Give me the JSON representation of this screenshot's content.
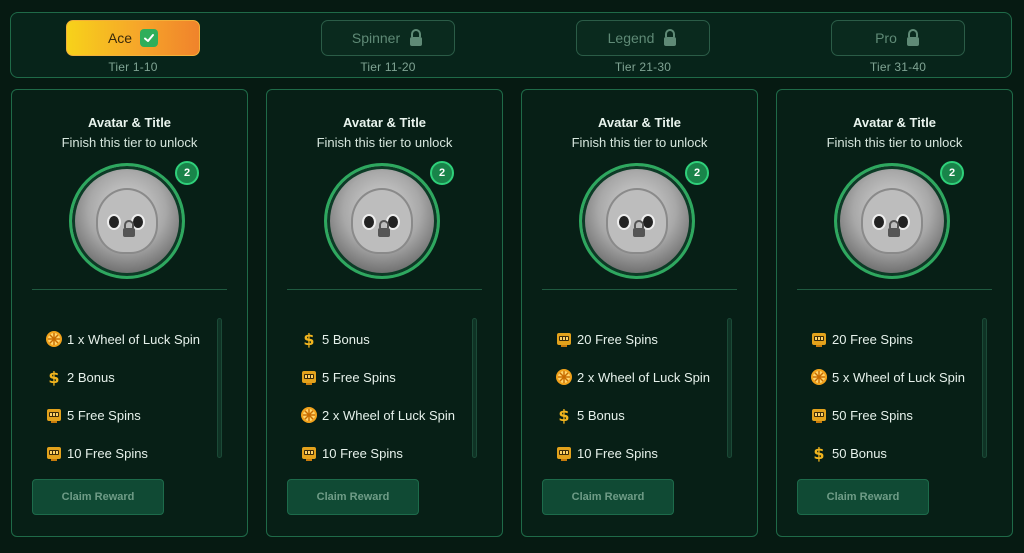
{
  "tiers": [
    {
      "name": "Ace",
      "range": "Tier 1-10",
      "active": true
    },
    {
      "name": "Spinner",
      "range": "Tier 11-20",
      "active": false
    },
    {
      "name": "Legend",
      "range": "Tier 21-30",
      "active": false
    },
    {
      "name": "Pro",
      "range": "Tier 31-40",
      "active": false
    }
  ],
  "cards": [
    {
      "title": "Avatar & Title",
      "subtitle": "Finish this tier to unlock",
      "badge": "2",
      "rewards": [
        {
          "icon": "wheel-icon",
          "label": "1 x Wheel of Luck Spin"
        },
        {
          "icon": "dollar-icon",
          "label": "2 Bonus"
        },
        {
          "icon": "slot-icon",
          "label": "5 Free Spins"
        },
        {
          "icon": "slot-icon",
          "label": "10 Free Spins"
        }
      ],
      "claim": "Claim Reward"
    },
    {
      "title": "Avatar & Title",
      "subtitle": "Finish this tier to unlock",
      "badge": "2",
      "rewards": [
        {
          "icon": "dollar-icon",
          "label": "5 Bonus"
        },
        {
          "icon": "slot-icon",
          "label": "5 Free Spins"
        },
        {
          "icon": "wheel-icon",
          "label": "2 x Wheel of Luck Spin"
        },
        {
          "icon": "slot-icon",
          "label": "10 Free Spins"
        }
      ],
      "claim": "Claim Reward"
    },
    {
      "title": "Avatar & Title",
      "subtitle": "Finish this tier to unlock",
      "badge": "2",
      "rewards": [
        {
          "icon": "slot-icon",
          "label": "20 Free Spins"
        },
        {
          "icon": "wheel-icon",
          "label": "2 x Wheel of Luck Spin"
        },
        {
          "icon": "dollar-icon",
          "label": "5 Bonus"
        },
        {
          "icon": "slot-icon",
          "label": "10 Free Spins"
        }
      ],
      "claim": "Claim Reward"
    },
    {
      "title": "Avatar & Title",
      "subtitle": "Finish this tier to unlock",
      "badge": "2",
      "rewards": [
        {
          "icon": "slot-icon",
          "label": "20 Free Spins"
        },
        {
          "icon": "wheel-icon",
          "label": "5 x Wheel of Luck Spin"
        },
        {
          "icon": "slot-icon",
          "label": "50 Free Spins"
        },
        {
          "icon": "dollar-icon",
          "label": "50 Bonus"
        }
      ],
      "claim": "Claim Reward"
    }
  ],
  "colors": {
    "accent": "#2ea85f",
    "background": "#061a12",
    "activeTier": "#f6a52a"
  }
}
